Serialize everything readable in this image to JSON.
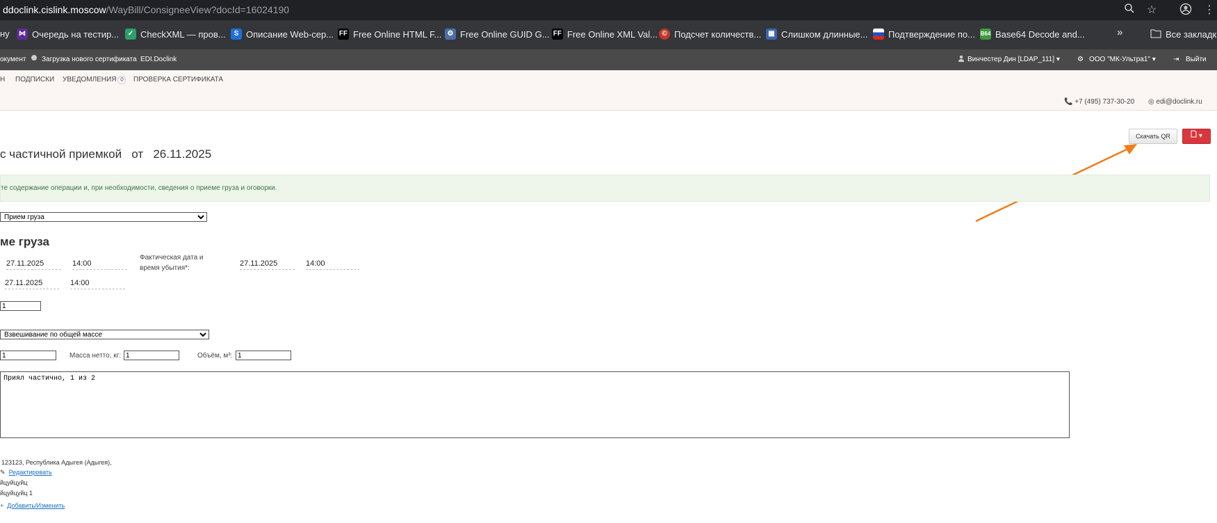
{
  "browser": {
    "url_host": "ddoclink.cislink.moscow",
    "url_path": "/WayBill/ConsigneeView?docId=16024190",
    "bookmarks": [
      {
        "label": "ну",
        "icon": "partial-icon"
      },
      {
        "label": "Очередь на тестир...",
        "icon": "visualstudio-icon"
      },
      {
        "label": "CheckXML — пров...",
        "icon": "checkxml-icon"
      },
      {
        "label": "Описание Web-сер...",
        "icon": "azure-icon"
      },
      {
        "label": "Free Online HTML F...",
        "icon": "ff-icon"
      },
      {
        "label": "Free Online GUID G...",
        "icon": "guid-icon"
      },
      {
        "label": "Free Online XML Val...",
        "icon": "ff-icon"
      },
      {
        "label": "Подсчет количеств...",
        "icon": "copyright-icon"
      },
      {
        "label": "Слишком длинные...",
        "icon": "window-icon"
      },
      {
        "label": "Подтверждение по...",
        "icon": "russia-flag-icon"
      },
      {
        "label": "Base64 Decode and...",
        "icon": "base64-icon"
      }
    ],
    "more_label": "»",
    "all_bookmarks_label": "Все закладки"
  },
  "appbar": {
    "item_doc": "окумент",
    "item_cert": "Загрузка нового сертификата",
    "item_edi": "EDI.Doclink",
    "user": "Винчестер Дин [LDAP_111]",
    "org": "ООО \"МК-Ультра1\"",
    "logout": "Выйти"
  },
  "nav": {
    "tab_prev": "Н",
    "tab_signatures": "ПОДПИСКИ",
    "tab_notifications": "УВЕДОМЛЕНИЯ",
    "notifications_count": "0",
    "tab_cert_check": "ПРОВЕРКА СЕРТИФИКАТА",
    "phone": "+7 (495) 737-30-20",
    "email": "edi@doclink.ru"
  },
  "actions": {
    "qr_button": "Скачать QR",
    "pdf_button": "▾"
  },
  "document": {
    "title_part": "с частичной приемкой",
    "from_word": "от",
    "date": "26.11.2025",
    "alert": "те содержание операции и, при необходимости, сведения о приеме груза и оговорки.",
    "operation_select": "Прием груза",
    "section_title": "ме груза",
    "date1": "27.11.2025",
    "time1": "14:00",
    "actual_label": "Фактическая дата и время убытия*:",
    "actual_date": "27.11.2025",
    "actual_time": "14:00",
    "date2": "27.11.2025",
    "time2": "14:00",
    "qty_value": "1",
    "weighing_select": "Взвешивание по общей массе",
    "gross_value": "1",
    "net_label": "Масса нетто, кг:",
    "net_value": "1",
    "volume_label": "Объём, м³:",
    "volume_value": "1",
    "note": "Приял частично, 1 из 2",
    "address": "123123, Республика Адыгея (Адыгея),",
    "edit_link": "Редактировать",
    "line_a": "йцуйцуйц",
    "line_b": "йцуйцуйц 1",
    "add_link": "Добавить/Изменить"
  },
  "colors": {
    "annotation_arrow": "#f07c1a",
    "pdf_button": "#d9363e",
    "alert_bg": "#eef6ec"
  }
}
